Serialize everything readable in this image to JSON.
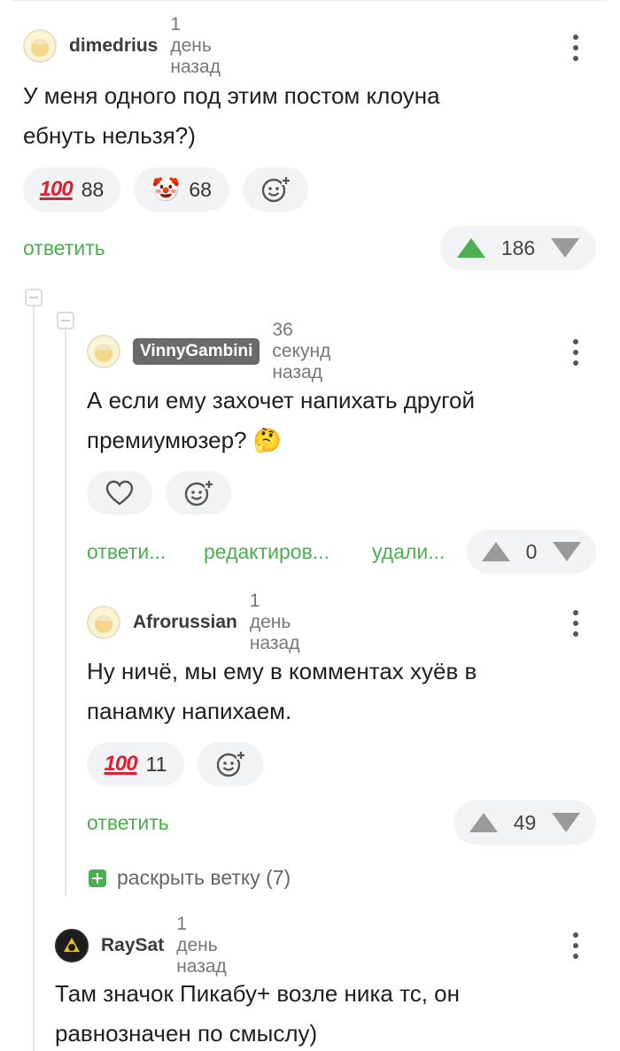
{
  "comments": [
    {
      "nick": "dimedrius",
      "time": "1 день назад",
      "text_lines": [
        "У меня одного под этим постом клоуна",
        "ебнуть нельзя?)"
      ],
      "reactions": [
        {
          "icon": "hundred-points-emoji",
          "glyph": "100",
          "count": "88"
        },
        {
          "icon": "clown-face-emoji",
          "glyph": "🤡",
          "count": "68"
        }
      ],
      "reply_label": "ответить",
      "rating": "186"
    },
    {
      "nick": "VinnyGambini",
      "time": "36 секунд назад",
      "text_lines": [
        "А если ему захочет напихать другой",
        "премиумюзер? 🤔"
      ],
      "actions": [
        "ответи...",
        "редактиров...",
        "удали..."
      ],
      "rating": "0"
    },
    {
      "nick": "Afrorussian",
      "time": "1 день назад",
      "text_lines": [
        "Ну ничё, мы ему в комментах хуёв в",
        "панамку напихаем."
      ],
      "reactions": [
        {
          "icon": "hundred-points-emoji",
          "glyph": "100",
          "count": "11"
        }
      ],
      "reply_label": "ответить",
      "rating": "49"
    },
    {
      "nick": "RaySat",
      "time": "1 день назад",
      "text_lines": [
        "Там значок Пикабу+ возле ника тс, он",
        "равнозначен по смыслу)"
      ]
    }
  ],
  "expand_thread": "раскрыть ветку (7)",
  "colors": {
    "accent": "#4caf50",
    "pill_bg": "#f2f3f5",
    "hundred": "#e21f32"
  }
}
